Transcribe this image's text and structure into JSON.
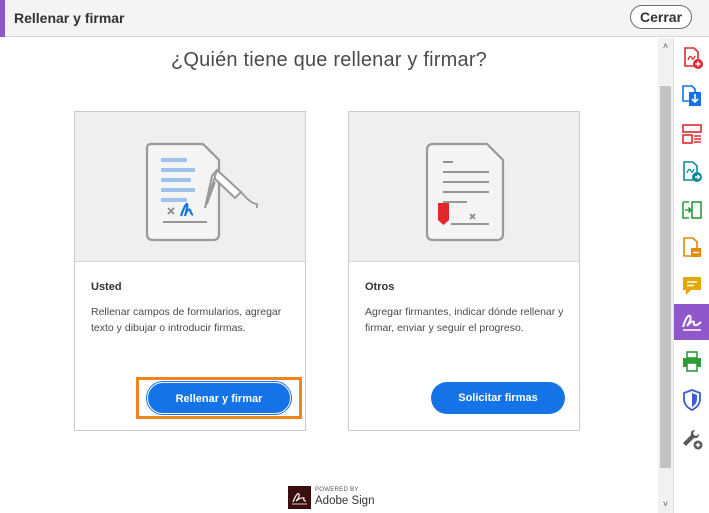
{
  "header": {
    "title": "Rellenar y firmar",
    "close_label": "Cerrar",
    "accent_color": "#8f57c9"
  },
  "main": {
    "question": "¿Quién tiene que rellenar y firmar?",
    "cards": [
      {
        "title": "Usted",
        "description": "Rellenar campos de formularios, agregar texto y dibujar o introducir firmas.",
        "button_label": "Rellenar y firmar",
        "illustration": "fill-and-sign-document-icon"
      },
      {
        "title": "Otros",
        "description": "Agregar firmantes, indicar dónde rellenar y firmar, enviar y seguir el progreso.",
        "button_label": "Solicitar firmas",
        "illustration": "request-signature-document-icon"
      }
    ],
    "button_color": "#1473e6",
    "focus_color": "#f0831e"
  },
  "footer": {
    "powered_by": "POWERED BY",
    "brand": "Adobe Sign"
  },
  "toolrail": {
    "active_color": "#8f57c9",
    "tools": [
      "create-pdf-icon",
      "export-pdf-icon",
      "organize-pages-icon",
      "edit-pdf-icon",
      "compare-files-icon",
      "combine-files-icon",
      "comment-icon",
      "fill-and-sign-icon",
      "print-production-icon",
      "protect-icon",
      "more-tools-icon"
    ]
  }
}
